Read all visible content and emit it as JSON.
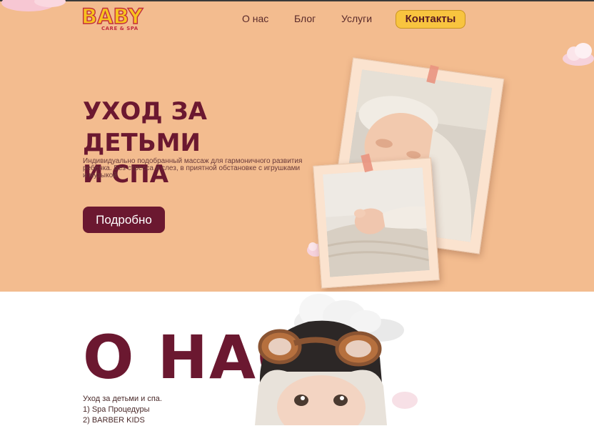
{
  "logo": {
    "main": "BABY",
    "sub": "CARE & SPA"
  },
  "nav": {
    "items": [
      "О нас",
      "Блог",
      "Услуги"
    ],
    "contact": "Контакты"
  },
  "hero": {
    "title_line1": "УХОД ЗА ДЕТЬМИ",
    "title_line2": "И СПА",
    "description": "Индивидуально подобранный массаж для гармоничного развития ребенка. Без стресса и слез, в приятной обстановке с игрушками и музыкой.",
    "button": "Подробно"
  },
  "about": {
    "title": "О НАС",
    "lines": [
      "Уход за детьми и спа.",
      "1) Spa Процедуры",
      "2) BARBER KIDS"
    ]
  },
  "colors": {
    "hero_bg": "#f3bc8f",
    "accent": "#6b1830",
    "contact_bg": "#f8c43f"
  }
}
